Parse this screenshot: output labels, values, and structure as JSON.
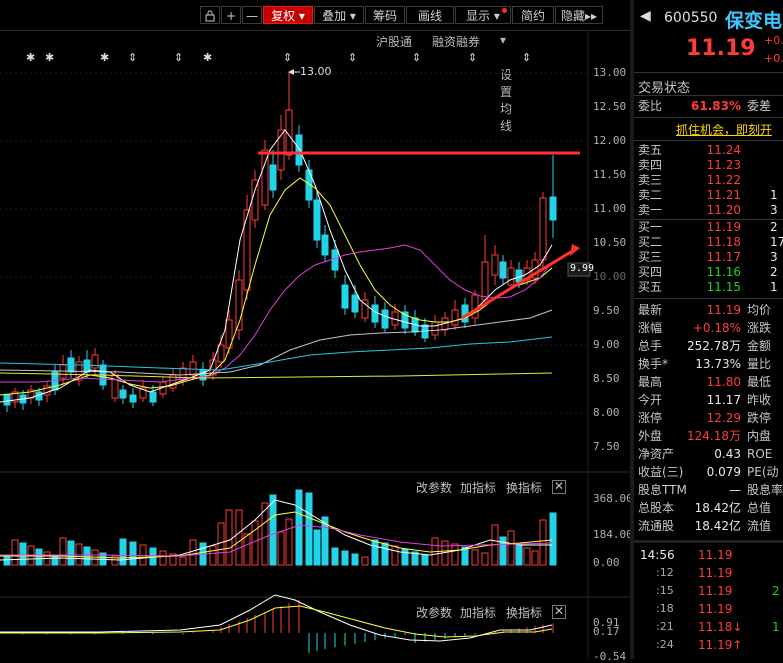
{
  "toolbar": {
    "buttons": [
      "复权",
      "叠加",
      "筹码",
      "画线",
      "显示",
      "简约",
      "隐藏"
    ],
    "lock_icon": "lock-icon",
    "plus": "+",
    "minus": "—",
    "more": "▸▸"
  },
  "subbar": {
    "items": [
      "沪股通",
      "融资融券",
      "设置均线"
    ]
  },
  "price_axis": [
    "13.00",
    "12.50",
    "12.00",
    "11.50",
    "11.00",
    "10.50",
    "10.00",
    "9.50",
    "9.00",
    "8.50",
    "8.00",
    "7.50"
  ],
  "current_price_tag": "9.99",
  "high_annotation": "13.00",
  "volume_axis": [
    "368.00",
    "184.00",
    "0.00"
  ],
  "macd_axis": [
    "0.91",
    "0.17",
    "-0.54"
  ],
  "panel_bar": {
    "items": [
      "改参数",
      "加指标",
      "换指标"
    ],
    "close": "✕"
  },
  "header": {
    "code": "600550",
    "name": "保变电",
    "price": "11.19",
    "chg_top": "+0.",
    "chg_bottom": "+0."
  },
  "trade_status": "交易状态",
  "weibi": {
    "label": "委比",
    "value": "61.83%",
    "label2": "委差"
  },
  "banner": "抓住机会，即刻开",
  "order_book": {
    "sells": [
      {
        "label": "卖五",
        "price": "11.24",
        "vol": ""
      },
      {
        "label": "卖四",
        "price": "11.23",
        "vol": ""
      },
      {
        "label": "卖三",
        "price": "11.22",
        "vol": ""
      },
      {
        "label": "卖二",
        "price": "11.21",
        "vol": "1"
      },
      {
        "label": "卖一",
        "price": "11.20",
        "vol": "3"
      }
    ],
    "buys": [
      {
        "label": "买一",
        "price": "11.19",
        "vol": "2"
      },
      {
        "label": "买二",
        "price": "11.18",
        "vol": "17"
      },
      {
        "label": "买三",
        "price": "11.17",
        "vol": "3"
      },
      {
        "label": "买四",
        "price": "11.16",
        "vol": "2"
      },
      {
        "label": "买五",
        "price": "11.15",
        "vol": "1"
      }
    ]
  },
  "quote": [
    {
      "l": "最新",
      "v": "11.19",
      "c": "red",
      "l2": "均价"
    },
    {
      "l": "涨幅",
      "v": "+0.18%",
      "c": "red",
      "l2": "涨跌"
    },
    {
      "l": "总手",
      "v": "252.78万",
      "c": "white",
      "l2": "金额"
    },
    {
      "l": "换手*",
      "v": "13.73%",
      "c": "white",
      "l2": "量比"
    },
    {
      "l": "最高",
      "v": "11.80",
      "c": "red",
      "l2": "最低"
    },
    {
      "l": "今开",
      "v": "11.17",
      "c": "white",
      "l2": "昨收"
    },
    {
      "l": "涨停",
      "v": "12.29",
      "c": "red",
      "l2": "跌停"
    },
    {
      "l": "外盘",
      "v": "124.18万",
      "c": "red",
      "l2": "内盘"
    },
    {
      "l": "净资产",
      "v": "0.43",
      "c": "white",
      "l2": "ROE"
    },
    {
      "l": "收益(三)",
      "v": "0.079",
      "c": "white",
      "l2": "PE(动"
    },
    {
      "l": "股息TTM",
      "v": "—",
      "c": "white",
      "l2": "股息率"
    },
    {
      "l": "总股本",
      "v": "18.42亿",
      "c": "white",
      "l2": "总值"
    },
    {
      "l": "流通股",
      "v": "18.42亿",
      "c": "white",
      "l2": "流值"
    }
  ],
  "ticks": [
    {
      "t": "14:56",
      "p": "11.19",
      "c": "red",
      "v": ""
    },
    {
      "t": ":12",
      "p": "11.19",
      "c": "red",
      "v": ""
    },
    {
      "t": ":15",
      "p": "11.19",
      "c": "red",
      "v": "2"
    },
    {
      "t": ":18",
      "p": "11.19",
      "c": "red",
      "v": ""
    },
    {
      "t": ":21",
      "p": "11.18↓",
      "c": "red",
      "v": "1"
    },
    {
      "t": ":24",
      "p": "11.19↑",
      "c": "red",
      "v": ""
    }
  ]
}
